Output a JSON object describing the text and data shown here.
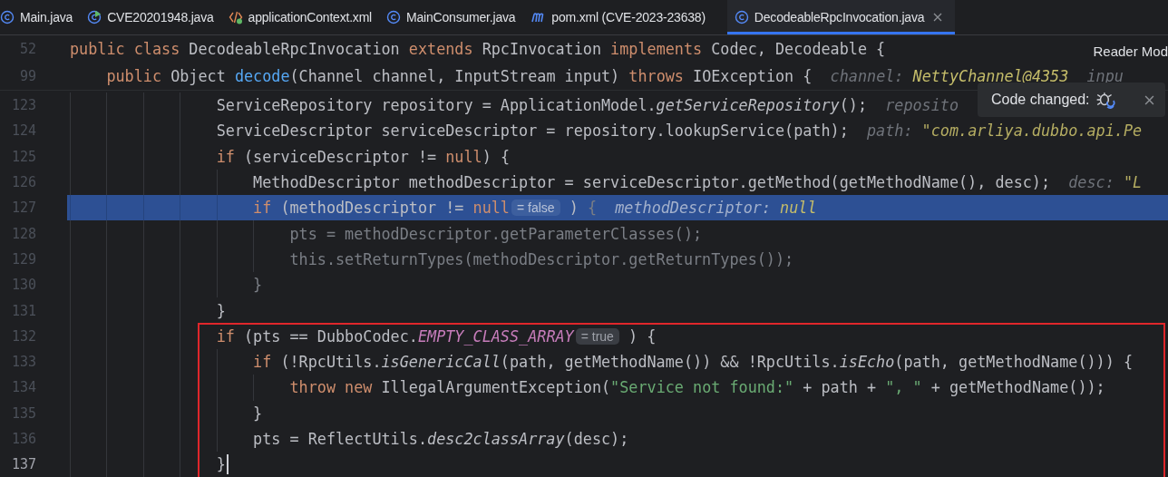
{
  "tabs": [
    {
      "label": "Main.java",
      "kind": "class",
      "selected": false
    },
    {
      "label": "CVE20201948.java",
      "kind": "runnable",
      "selected": false
    },
    {
      "label": "applicationContext.xml",
      "kind": "xml",
      "selected": false
    },
    {
      "label": "MainConsumer.java",
      "kind": "class",
      "selected": false
    },
    {
      "label": "pom.xml (CVE-2023-23638)",
      "kind": "maven",
      "selected": false
    },
    {
      "label": "DecodeableRpcInvocation.java",
      "kind": "class",
      "selected": true
    }
  ],
  "reader_mode": {
    "label": "Reader Mod"
  },
  "notification": {
    "text": "Code changed:"
  },
  "sticky_lines": [
    {
      "number": "52",
      "segments": [
        {
          "kind": "code",
          "tokens": [
            {
              "kind": "kw",
              "text": "public class "
            },
            {
              "kind": "plain",
              "text": "DecodeableRpcInvocation "
            },
            {
              "kind": "kw",
              "text": "extends "
            },
            {
              "kind": "plain",
              "text": "RpcInvocation "
            },
            {
              "kind": "kw",
              "text": "implements "
            },
            {
              "kind": "plain",
              "text": "Codec, Decodeable {"
            }
          ]
        }
      ]
    },
    {
      "number": "99",
      "segments": [
        {
          "kind": "code",
          "tokens": [
            {
              "kind": "kw",
              "text": "    public "
            },
            {
              "kind": "plain",
              "text": "Object "
            },
            {
              "kind": "fn",
              "text": "decode"
            },
            {
              "kind": "plain",
              "text": "(Channel channel, InputStream input) "
            },
            {
              "kind": "kw",
              "text": "throws "
            },
            {
              "kind": "plain",
              "text": "IOException {"
            }
          ]
        },
        {
          "kind": "hint",
          "tokens": [
            {
              "kind": "name",
              "text": "channel: "
            },
            {
              "kind": "value",
              "text": "NettyChannel@4353"
            }
          ]
        },
        {
          "kind": "hint",
          "tokens": [
            {
              "kind": "name",
              "text": "inpu"
            }
          ]
        }
      ]
    }
  ],
  "blocks": [
    {
      "framed": false,
      "lines": [
        {
          "number": "123",
          "current": false,
          "caret": false,
          "segments": [
            {
              "kind": "code",
              "tokens": [
                {
                  "kind": "plain",
                  "text": "                ServiceRepository repository = ApplicationModel."
                },
                {
                  "kind": "static",
                  "text": "getServiceRepository"
                },
                {
                  "kind": "plain",
                  "text": "();"
                }
              ]
            },
            {
              "kind": "hint",
              "tokens": [
                {
                  "kind": "name",
                  "text": "reposito"
                }
              ]
            }
          ]
        },
        {
          "number": "124",
          "current": false,
          "caret": false,
          "segments": [
            {
              "kind": "code",
              "tokens": [
                {
                  "kind": "plain",
                  "text": "                ServiceDescriptor serviceDescriptor = repository.lookupService(path);"
                }
              ]
            },
            {
              "kind": "hint",
              "tokens": [
                {
                  "kind": "name",
                  "text": "path: "
                },
                {
                  "kind": "str",
                  "text": "\"com.arliya.dubbo.api.Pe"
                }
              ]
            }
          ]
        },
        {
          "number": "125",
          "current": false,
          "caret": false,
          "segments": [
            {
              "kind": "code",
              "tokens": [
                {
                  "kind": "kw",
                  "text": "                if "
                },
                {
                  "kind": "plain",
                  "text": "(serviceDescriptor != "
                },
                {
                  "kind": "kw",
                  "text": "null"
                },
                {
                  "kind": "plain",
                  "text": ") {"
                }
              ]
            }
          ]
        },
        {
          "number": "126",
          "current": false,
          "caret": false,
          "segments": [
            {
              "kind": "code",
              "tokens": [
                {
                  "kind": "plain",
                  "text": "                    MethodDescriptor methodDescriptor = serviceDescriptor.getMethod(getMethodName(), desc);"
                }
              ]
            },
            {
              "kind": "hint",
              "tokens": [
                {
                  "kind": "name",
                  "text": "desc: "
                },
                {
                  "kind": "str",
                  "text": "\"L"
                }
              ]
            }
          ]
        },
        {
          "number": "127",
          "current": true,
          "caret": false,
          "segments": [
            {
              "kind": "code",
              "tokens": [
                {
                  "kind": "kw",
                  "text": "                    if "
                },
                {
                  "kind": "plain",
                  "text": "(methodDescriptor != "
                },
                {
                  "kind": "kw",
                  "text": "null"
                }
              ]
            },
            {
              "kind": "badge",
              "text": "= false"
            },
            {
              "kind": "code",
              "tokens": [
                {
                  "kind": "plain",
                  "text": " )"
                },
                {
                  "kind": "dim",
                  "text": " {"
                }
              ]
            },
            {
              "kind": "hint",
              "tokens": [
                {
                  "kind": "name",
                  "text": "methodDescriptor: "
                },
                {
                  "kind": "value",
                  "text": "null"
                }
              ]
            }
          ]
        },
        {
          "number": "128",
          "current": false,
          "caret": false,
          "segments": [
            {
              "kind": "code",
              "tokens": [
                {
                  "kind": "dim",
                  "text": "                        pts = methodDescriptor.getParameterClasses();"
                }
              ]
            }
          ]
        },
        {
          "number": "129",
          "current": false,
          "caret": false,
          "segments": [
            {
              "kind": "code",
              "tokens": [
                {
                  "kind": "dim",
                  "text": "                        this.setReturnTypes(methodDescriptor.getReturnTypes());"
                }
              ]
            }
          ]
        },
        {
          "number": "130",
          "current": false,
          "caret": false,
          "segments": [
            {
              "kind": "code",
              "tokens": [
                {
                  "kind": "dim",
                  "text": "                    }"
                }
              ]
            }
          ]
        },
        {
          "number": "131",
          "current": false,
          "caret": false,
          "segments": [
            {
              "kind": "code",
              "tokens": [
                {
                  "kind": "plain",
                  "text": "                }"
                }
              ]
            }
          ]
        }
      ]
    },
    {
      "framed": true,
      "lines": [
        {
          "number": "132",
          "current": false,
          "caret": false,
          "segments": [
            {
              "kind": "code",
              "tokens": [
                {
                  "kind": "kw",
                  "text": "                if "
                },
                {
                  "kind": "plain",
                  "text": "(pts == DubboCodec."
                },
                {
                  "kind": "const",
                  "text": "EMPTY_CLASS_ARRAY"
                }
              ]
            },
            {
              "kind": "badge",
              "text": "= true"
            },
            {
              "kind": "code",
              "tokens": [
                {
                  "kind": "plain",
                  "text": " ) {"
                }
              ]
            }
          ]
        },
        {
          "number": "133",
          "current": false,
          "caret": false,
          "segments": [
            {
              "kind": "code",
              "tokens": [
                {
                  "kind": "kw",
                  "text": "                    if "
                },
                {
                  "kind": "plain",
                  "text": "(!RpcUtils."
                },
                {
                  "kind": "static",
                  "text": "isGenericCall"
                },
                {
                  "kind": "plain",
                  "text": "(path, getMethodName()) && !RpcUtils."
                },
                {
                  "kind": "static",
                  "text": "isEcho"
                },
                {
                  "kind": "plain",
                  "text": "(path, getMethodName())) {"
                }
              ]
            }
          ]
        },
        {
          "number": "134",
          "current": false,
          "caret": false,
          "segments": [
            {
              "kind": "code",
              "tokens": [
                {
                  "kind": "kw",
                  "text": "                        throw new "
                },
                {
                  "kind": "plain",
                  "text": "IllegalArgumentException("
                },
                {
                  "kind": "str",
                  "text": "\"Service not found:\""
                },
                {
                  "kind": "plain",
                  "text": " + path + "
                },
                {
                  "kind": "str",
                  "text": "\", \""
                },
                {
                  "kind": "plain",
                  "text": " + getMethodName());"
                }
              ]
            }
          ]
        },
        {
          "number": "135",
          "current": false,
          "caret": false,
          "segments": [
            {
              "kind": "code",
              "tokens": [
                {
                  "kind": "plain",
                  "text": "                    }"
                }
              ]
            }
          ]
        },
        {
          "number": "136",
          "current": false,
          "caret": false,
          "segments": [
            {
              "kind": "code",
              "tokens": [
                {
                  "kind": "plain",
                  "text": "                    pts = ReflectUtils."
                },
                {
                  "kind": "static",
                  "text": "desc2classArray"
                },
                {
                  "kind": "plain",
                  "text": "(desc);"
                }
              ]
            }
          ]
        },
        {
          "number": "137",
          "current": false,
          "caret": true,
          "segments": [
            {
              "kind": "code",
              "tokens": [
                {
                  "kind": "plain",
                  "text": "                }"
                }
              ]
            }
          ]
        }
      ]
    }
  ]
}
